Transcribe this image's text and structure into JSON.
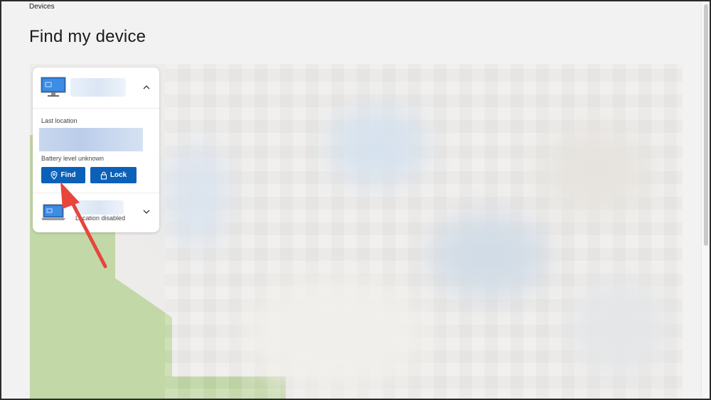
{
  "breadcrumb": "Devices",
  "page_title": "Find my device",
  "device_card": {
    "device1": {
      "icon": "desktop-monitor-icon",
      "expand_icon": "chevron-up-icon",
      "last_location_label": "Last location",
      "battery_text": "Battery level unknown",
      "find_button": {
        "label": "Find",
        "icon": "location-pin-icon"
      },
      "lock_button": {
        "label": "Lock",
        "icon": "padlock-icon"
      }
    },
    "device2": {
      "icon": "laptop-icon",
      "status_text": "Location disabled",
      "expand_icon": "chevron-down-icon"
    }
  },
  "colors": {
    "accent": "#0b61b8",
    "map_green": "#c3d8a7",
    "annotation_arrow": "#e8453c"
  }
}
